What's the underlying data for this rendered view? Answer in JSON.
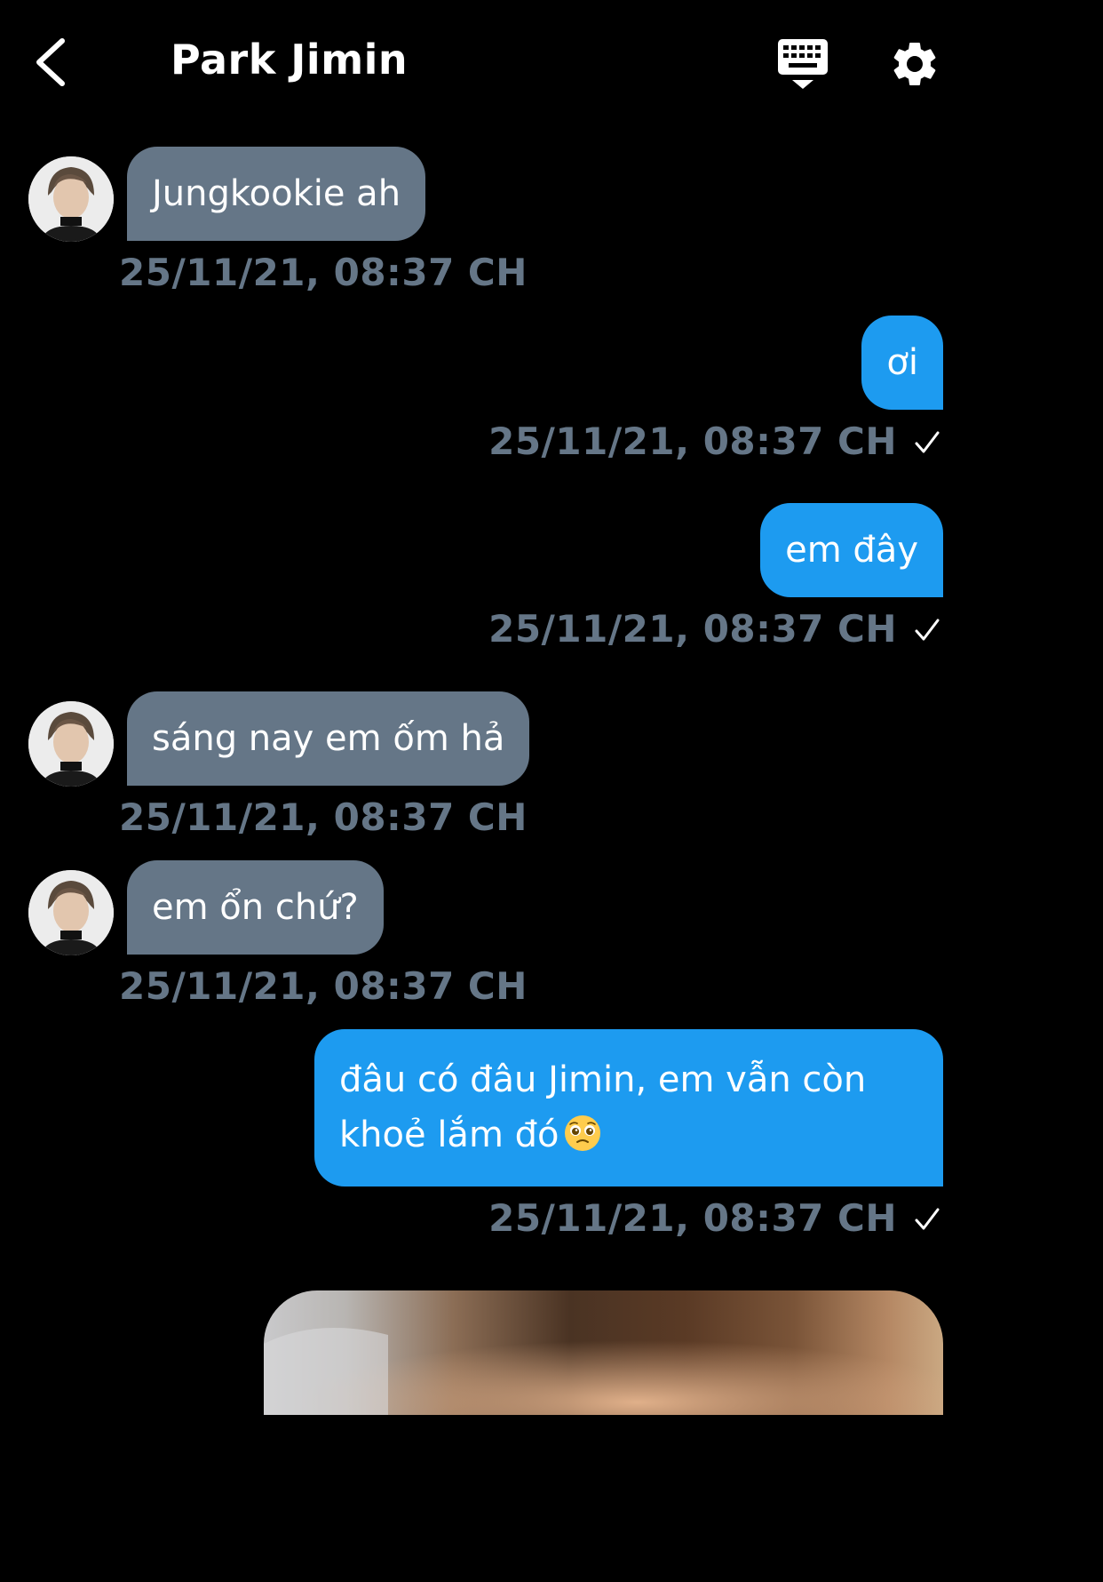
{
  "header": {
    "title": "Park Jimin"
  },
  "messages": [
    {
      "direction": "in",
      "text": "Jungkookie ah",
      "timestamp": "25/11/21, 08:37 CH"
    },
    {
      "direction": "out",
      "text": "ơi",
      "timestamp": "25/11/21, 08:37 CH",
      "status": "sent"
    },
    {
      "direction": "out",
      "text": "em đây",
      "timestamp": "25/11/21, 08:37 CH",
      "status": "sent"
    },
    {
      "direction": "in",
      "text": "sáng nay em ốm hả",
      "timestamp": "25/11/21, 08:37 CH"
    },
    {
      "direction": "in",
      "text": "em ổn chứ?",
      "timestamp": "25/11/21, 08:37 CH"
    },
    {
      "direction": "out",
      "text_line1": "đâu có đâu Jimin, em vẫn còn",
      "text_line2": "khoẻ lắm đó",
      "emoji": "pleading-face",
      "timestamp": "25/11/21, 08:37 CH",
      "status": "sent"
    }
  ],
  "icons": {
    "back": "chevron-left-icon",
    "keyboard": "keyboard-icon",
    "settings": "gear-icon",
    "check": "checkmark-icon"
  },
  "colors": {
    "background": "#000000",
    "incoming_bubble": "#657687",
    "outgoing_bubble": "#1d9bf0",
    "timestamp": "#657687"
  }
}
